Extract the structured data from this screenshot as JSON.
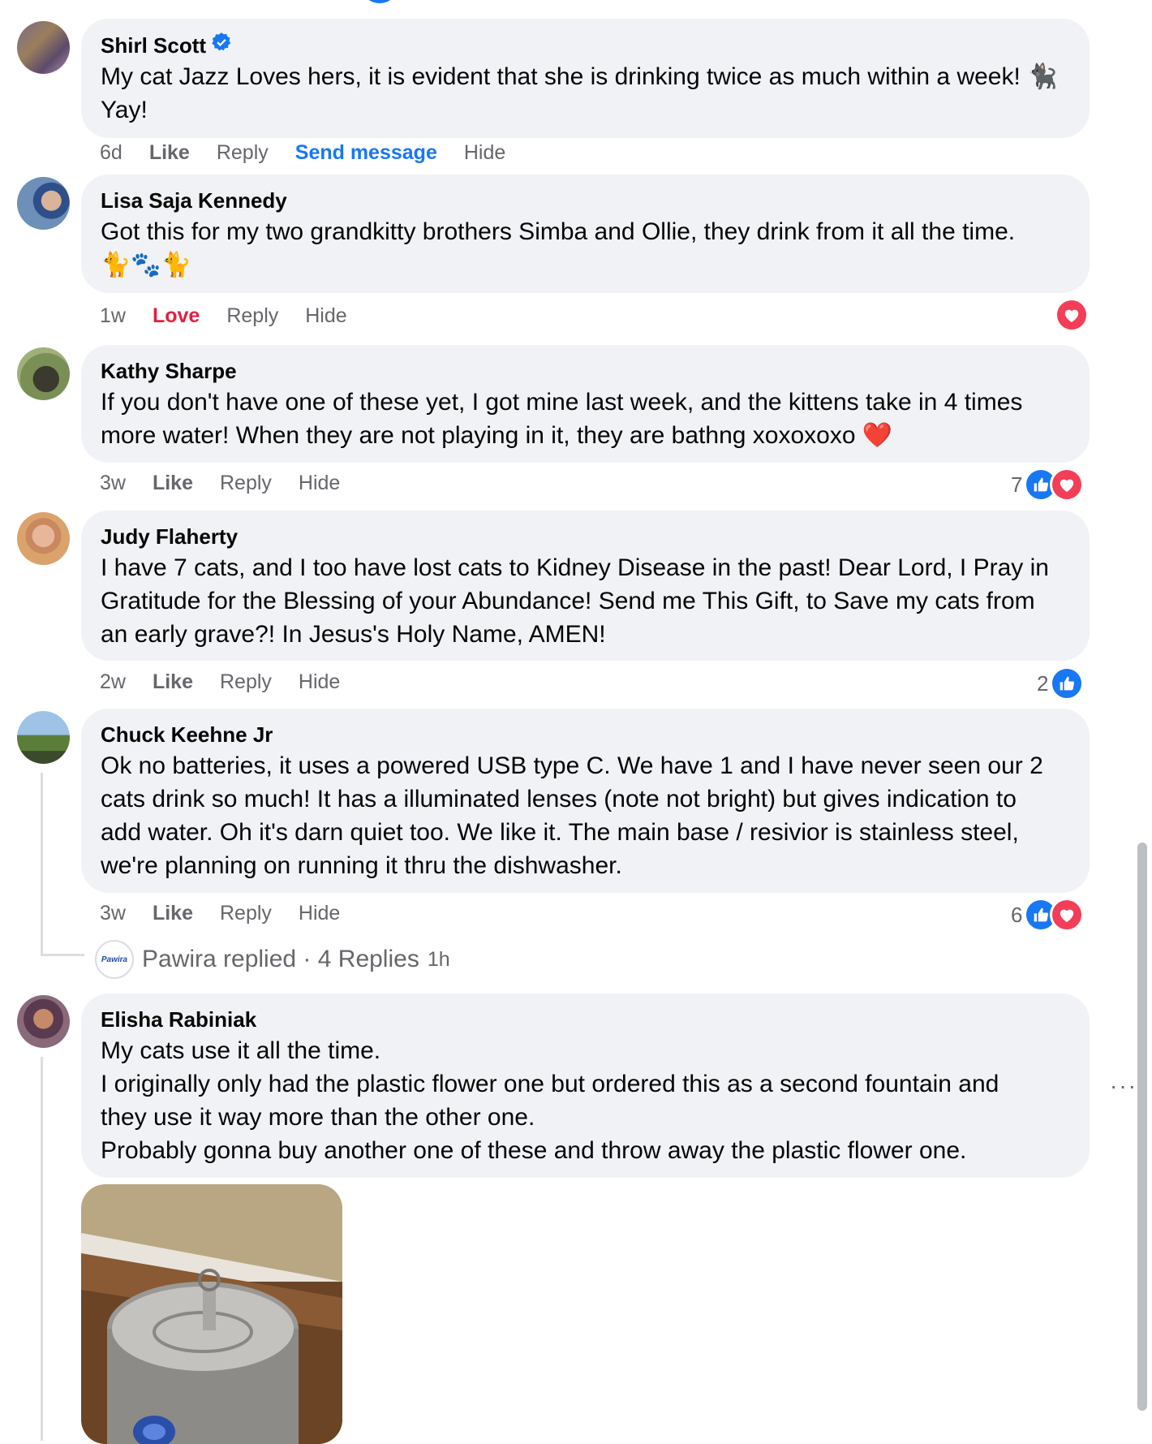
{
  "comments": [
    {
      "author": "Shirl Scott",
      "verified": true,
      "text": "My cat Jazz Loves hers, it is evident that she is drinking twice as much within a week! 🐈‍⬛\nYay!",
      "time": "6d",
      "actions": [
        "Like",
        "Reply",
        "Send message",
        "Hide"
      ]
    },
    {
      "author": "Lisa Saja Kennedy",
      "text": "Got this for my two grandkitty brothers Simba and Ollie, they drink from it all the time.\n🐈🐾🐈",
      "time": "1w",
      "actions": [
        "Love",
        "Reply",
        "Hide"
      ]
    },
    {
      "author": "Kathy Sharpe",
      "text": "If you don't have one of these yet, I got mine last week, and the kittens take in 4 times\nmore water! When they are not playing in it, they are bathng xoxoxoxo ❤️",
      "time": "3w",
      "actions": [
        "Like",
        "Reply",
        "Hide"
      ],
      "reaction_count": "7"
    },
    {
      "author": "Judy Flaherty",
      "text": "I have 7 cats, and I too have lost cats to Kidney Disease in the past! Dear Lord, I Pray in\nGratitude for the Blessing of your Abundance! Send me This Gift, to Save my cats from\nan early grave?! In Jesus's Holy Name, AMEN!",
      "time": "2w",
      "actions": [
        "Like",
        "Reply",
        "Hide"
      ],
      "reaction_count": "2"
    },
    {
      "author": "Chuck Keehne Jr",
      "text": "Ok no batteries, it uses a powered USB type C. We have 1 and I have never seen our 2\ncats drink so much! It has a illuminated lenses (note not bright) but gives indication to\nadd water. Oh it's darn quiet too. We like it. The main base / resivior is stainless steel,\nwe're planning on running it thru the dishwasher.",
      "time": "3w",
      "actions": [
        "Like",
        "Reply",
        "Hide"
      ],
      "reaction_count": "6"
    },
    {
      "author": "Elisha Rabiniak",
      "text": "My cats use it all the time.\nI originally only had the plastic flower one but ordered this as a second fountain and\nthey use it way more than the other one.\nProbably gonna buy another one of these and throw away the plastic flower one."
    }
  ],
  "reply_summary": {
    "logo_text": "Pawira",
    "label": "Pawira replied · 4 Replies",
    "time": "1h"
  },
  "more_options": "···",
  "colors": {
    "like_blue": "#1877f2",
    "love_red": "#e41e3f",
    "bubble_bg": "#f0f2f5",
    "secondary_text": "#65676b"
  }
}
